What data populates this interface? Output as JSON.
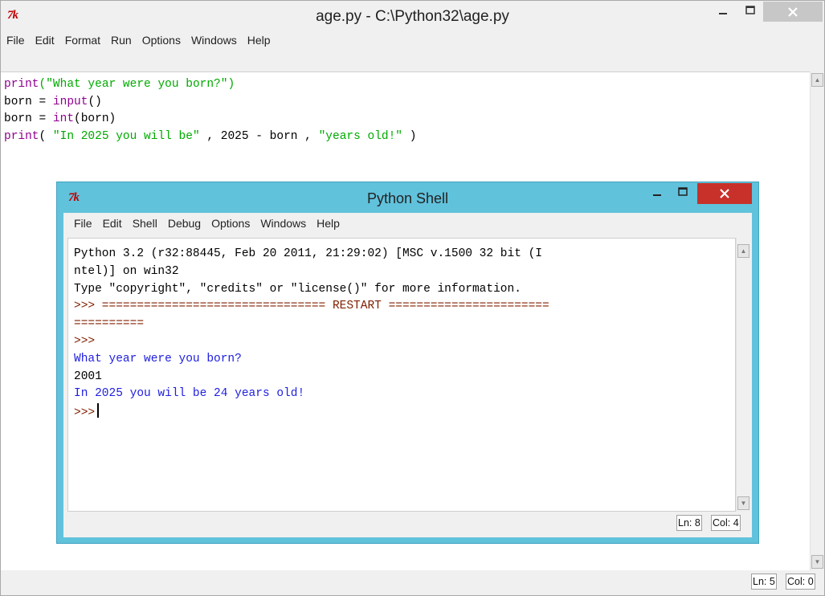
{
  "editor": {
    "icon": "7k",
    "title": "age.py - C:\\Python32\\age.py",
    "menu": [
      "File",
      "Edit",
      "Format",
      "Run",
      "Options",
      "Windows",
      "Help"
    ],
    "code": {
      "l1_kw": "print",
      "l1_str": "(\"What year were you born?\")",
      "l2_a": "born = ",
      "l2_kw": "input",
      "l2_b": "()",
      "l3_a": "born = ",
      "l3_kw": "int",
      "l3_b": "(born)",
      "l4_kw": "print",
      "l4_a": "( ",
      "l4_str1": "\"In 2025 you will be\"",
      "l4_b": " , 2025 - born , ",
      "l4_str2": "\"years old!\"",
      "l4_c": " )"
    },
    "status": {
      "line": "Ln: 5",
      "col": "Col: 0"
    }
  },
  "shell": {
    "icon": "7k",
    "title": "Python Shell",
    "menu": [
      "File",
      "Edit",
      "Shell",
      "Debug",
      "Options",
      "Windows",
      "Help"
    ],
    "lines": {
      "l1": "Python 3.2 (r32:88445, Feb 20 2011, 21:29:02) [MSC v.1500 32 bit (I",
      "l2": "ntel)] on win32",
      "l3": "Type \"copyright\", \"credits\" or \"license()\" for more information.",
      "l4": ">>> ================================ RESTART =======================",
      "l5": "==========",
      "l6": ">>>",
      "l7": "What year were you born?",
      "l8": "2001",
      "l9": "In 2025 you will be 24 years old!",
      "l10": ">>>"
    },
    "status": {
      "line": "Ln: 8",
      "col": "Col: 4"
    }
  },
  "colors": {
    "close_button": "#c7312a",
    "shell_frame": "#61c2dc",
    "keyword": "#900090",
    "string": "#00aa00",
    "output": "#2020e0"
  }
}
